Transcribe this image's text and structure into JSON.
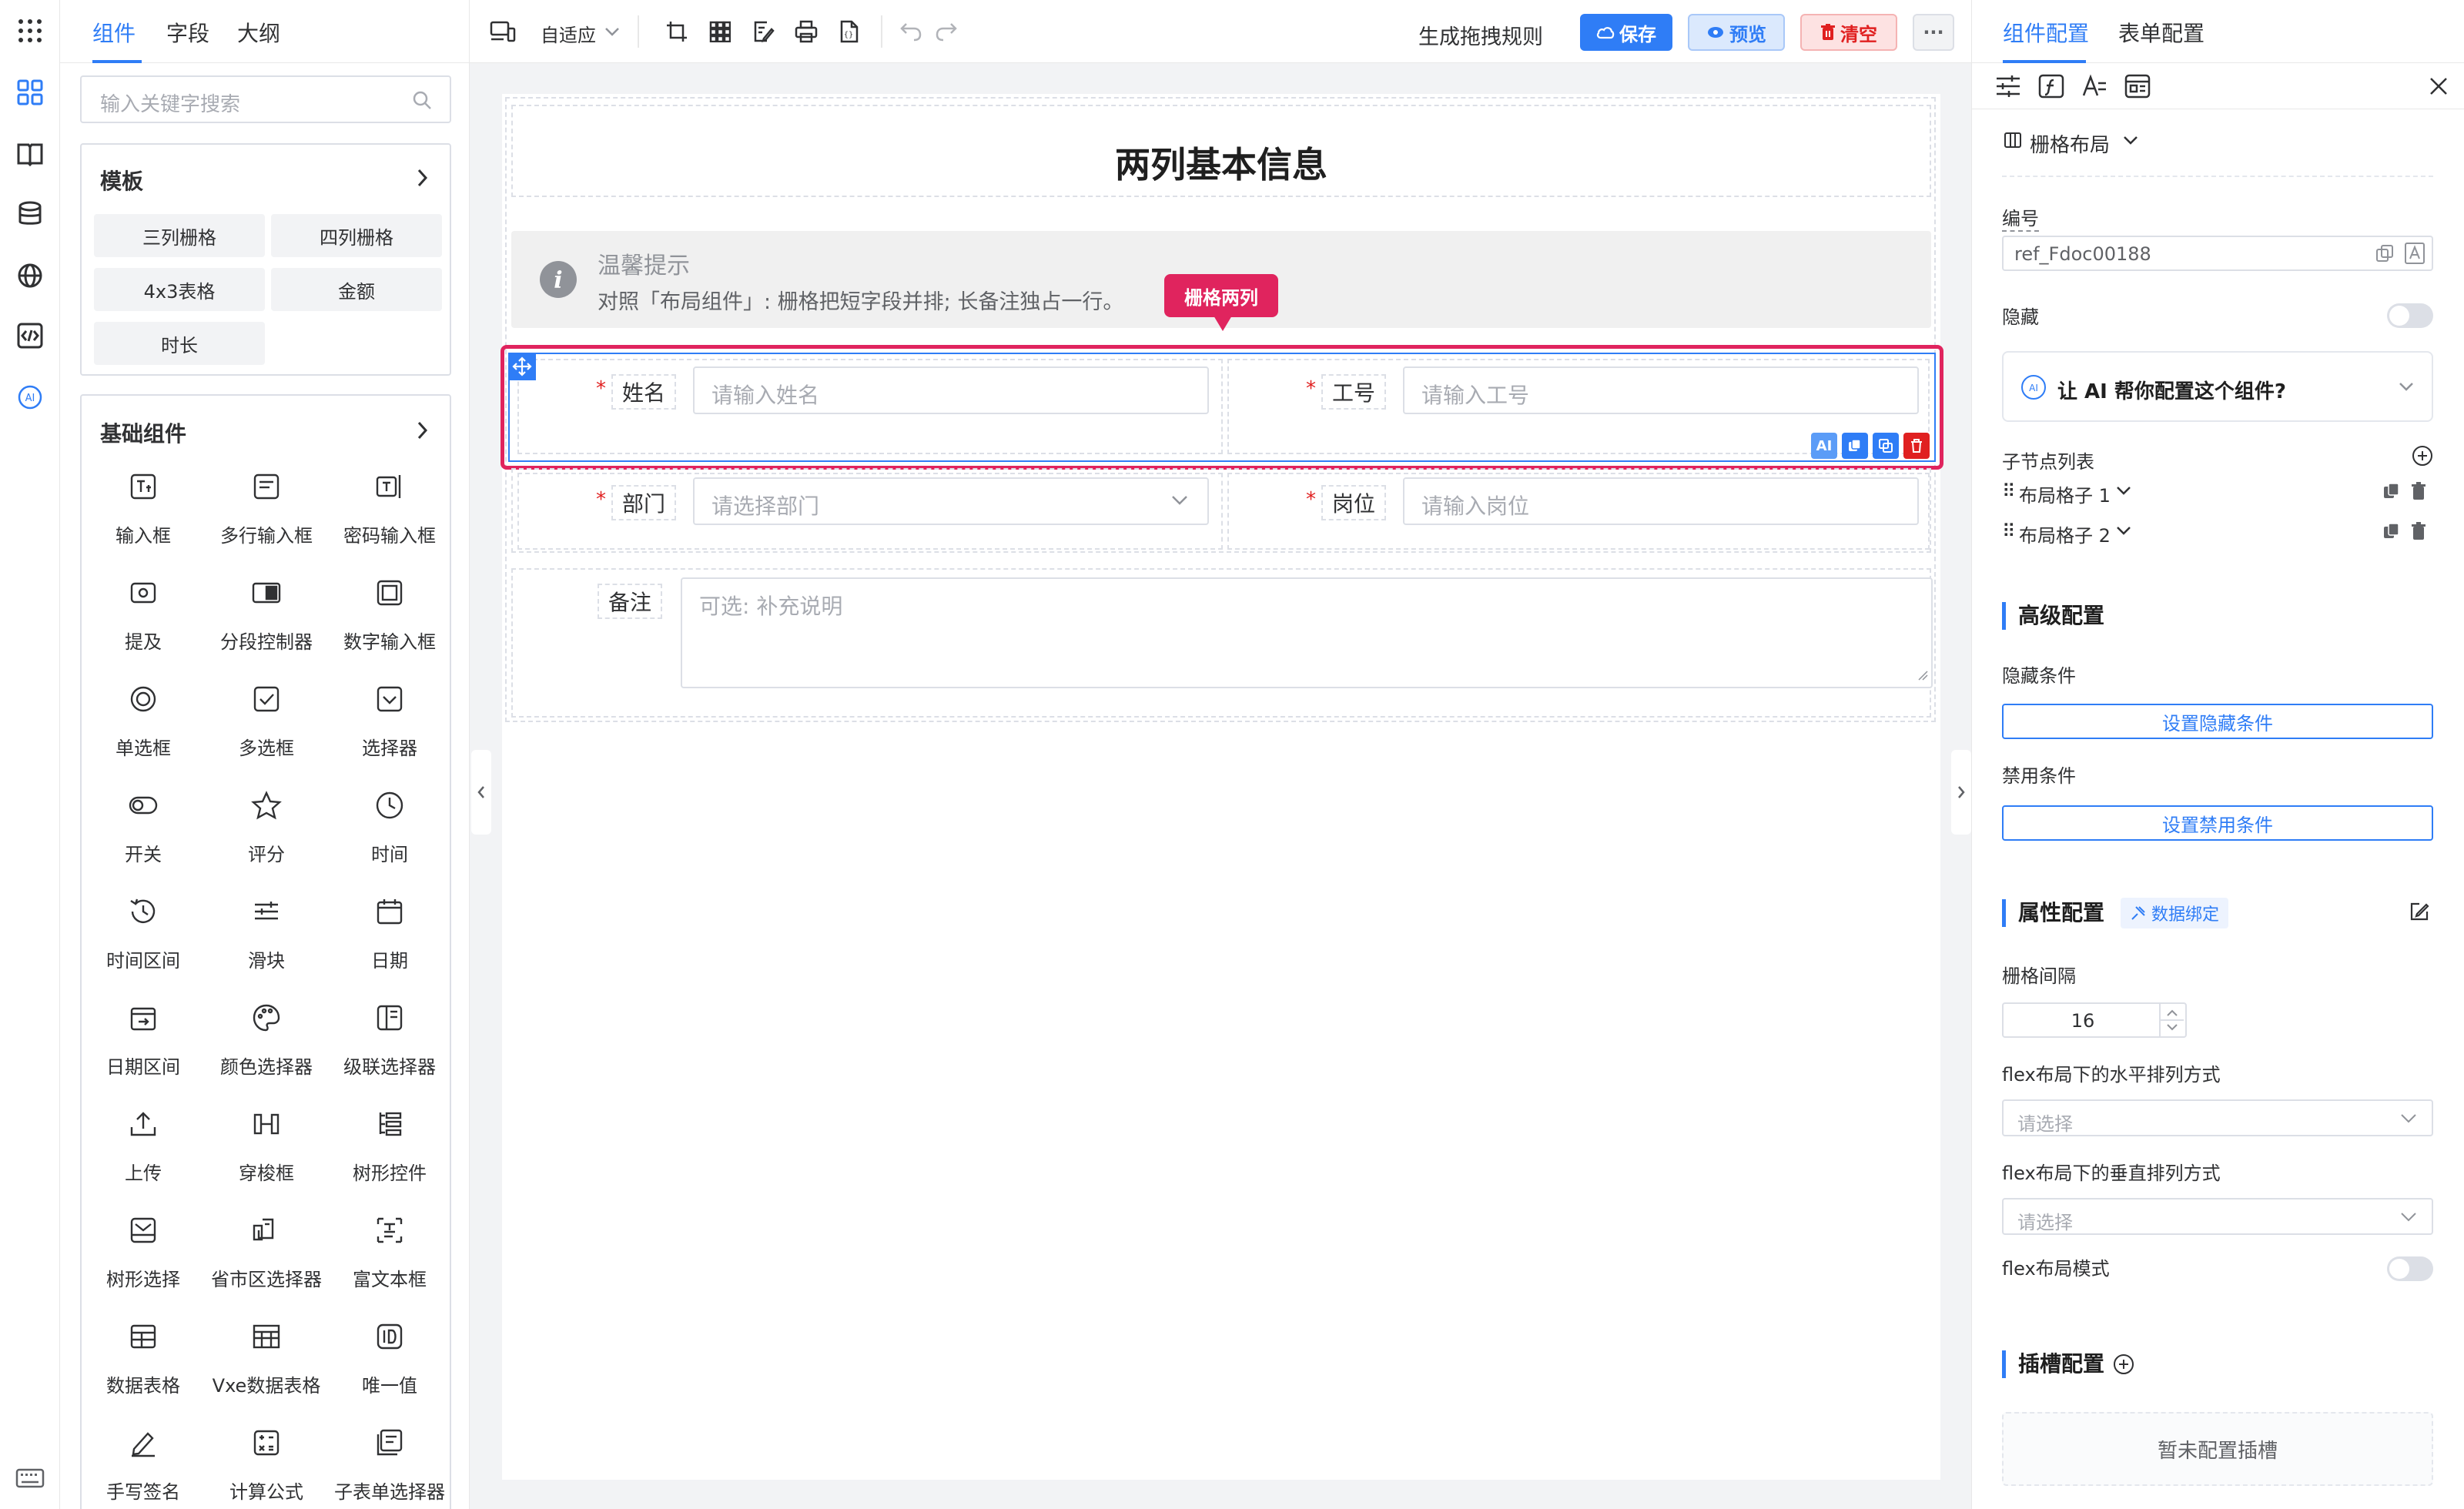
{
  "left_panel": {
    "tabs": [
      "组件",
      "字段",
      "大纲"
    ],
    "search_placeholder": "输入关键字搜索",
    "templates": {
      "title": "模板",
      "items": [
        "三列栅格",
        "四列栅格",
        "4x3表格",
        "金额",
        "时长"
      ]
    },
    "basic": {
      "title": "基础组件",
      "items": [
        {
          "label": "输入框",
          "icon": "text-input-icon"
        },
        {
          "label": "多行输入框",
          "icon": "textarea-icon"
        },
        {
          "label": "密码输入框",
          "icon": "password-icon"
        },
        {
          "label": "提及",
          "icon": "mention-icon"
        },
        {
          "label": "分段控制器",
          "icon": "segmented-icon"
        },
        {
          "label": "数字输入框",
          "icon": "number-icon"
        },
        {
          "label": "单选框",
          "icon": "radio-icon"
        },
        {
          "label": "多选框",
          "icon": "checkbox-icon"
        },
        {
          "label": "选择器",
          "icon": "select-icon"
        },
        {
          "label": "开关",
          "icon": "switch-icon"
        },
        {
          "label": "评分",
          "icon": "star-icon"
        },
        {
          "label": "时间",
          "icon": "clock-icon"
        },
        {
          "label": "时间区间",
          "icon": "time-range-icon"
        },
        {
          "label": "滑块",
          "icon": "slider-icon"
        },
        {
          "label": "日期",
          "icon": "calendar-icon"
        },
        {
          "label": "日期区间",
          "icon": "date-range-icon"
        },
        {
          "label": "颜色选择器",
          "icon": "palette-icon"
        },
        {
          "label": "级联选择器",
          "icon": "cascader-icon"
        },
        {
          "label": "上传",
          "icon": "upload-icon"
        },
        {
          "label": "穿梭框",
          "icon": "transfer-icon"
        },
        {
          "label": "树形控件",
          "icon": "tree-icon"
        },
        {
          "label": "树形选择",
          "icon": "tree-select-icon"
        },
        {
          "label": "省市区选择器",
          "icon": "region-icon"
        },
        {
          "label": "富文本框",
          "icon": "rich-text-icon"
        },
        {
          "label": "数据表格",
          "icon": "table-icon"
        },
        {
          "label": "Vxe数据表格",
          "icon": "vxe-table-icon"
        },
        {
          "label": "唯一值",
          "icon": "id-icon"
        },
        {
          "label": "手写签名",
          "icon": "signature-icon"
        },
        {
          "label": "计算公式",
          "icon": "calculator-icon"
        },
        {
          "label": "子表单选择器",
          "icon": "subform-icon"
        }
      ]
    }
  },
  "toolbar": {
    "adaptive_label": "自适应",
    "generate_rules": "生成拖拽规则",
    "save": "保存",
    "preview": "预览",
    "clear": "清空",
    "more": "···"
  },
  "form": {
    "title": "两列基本信息",
    "alert_title": "温馨提示",
    "alert_desc": "对照「布局组件」: 栅格把短字段并排; 长备注独占一行。",
    "tip_label": "栅格两列",
    "fields": {
      "name_label": "姓名",
      "name_placeholder": "请输入姓名",
      "emp_label": "工号",
      "emp_placeholder": "请输入工号",
      "dept_label": "部门",
      "dept_placeholder": "请选择部门",
      "post_label": "岗位",
      "post_placeholder": "请输入岗位",
      "remark_label": "备注",
      "remark_placeholder": "可选: 补充说明"
    },
    "required_mark": "*",
    "ai_badge": "AI"
  },
  "right_panel": {
    "tabs": [
      "组件配置",
      "表单配置"
    ],
    "component_type": "栅格布局",
    "id_label": "编号",
    "id_value": "ref_Fdoc00188",
    "hidden_label": "隐藏",
    "ai_prompt": "让 AI 帮你配置这个组件?",
    "children_label": "子节点列表",
    "children": [
      "布局格子 1",
      "布局格子 2"
    ],
    "advanced_title": "高级配置",
    "hide_condition_label": "隐藏条件",
    "hide_condition_btn": "设置隐藏条件",
    "disable_condition_label": "禁用条件",
    "disable_condition_btn": "设置禁用条件",
    "props_title": "属性配置",
    "data_binding": "数据绑定",
    "gutter_label": "栅格间隔",
    "gutter_value": "16",
    "flex_h_label": "flex布局下的水平排列方式",
    "flex_v_label": "flex布局下的垂直排列方式",
    "select_placeholder": "请选择",
    "flex_mode_label": "flex布局模式",
    "slot_title": "插槽配置",
    "slot_empty": "暂未配置插槽"
  },
  "colors": {
    "accent": "#2f7df6",
    "danger": "#e02020",
    "highlight": "#e0245e"
  }
}
